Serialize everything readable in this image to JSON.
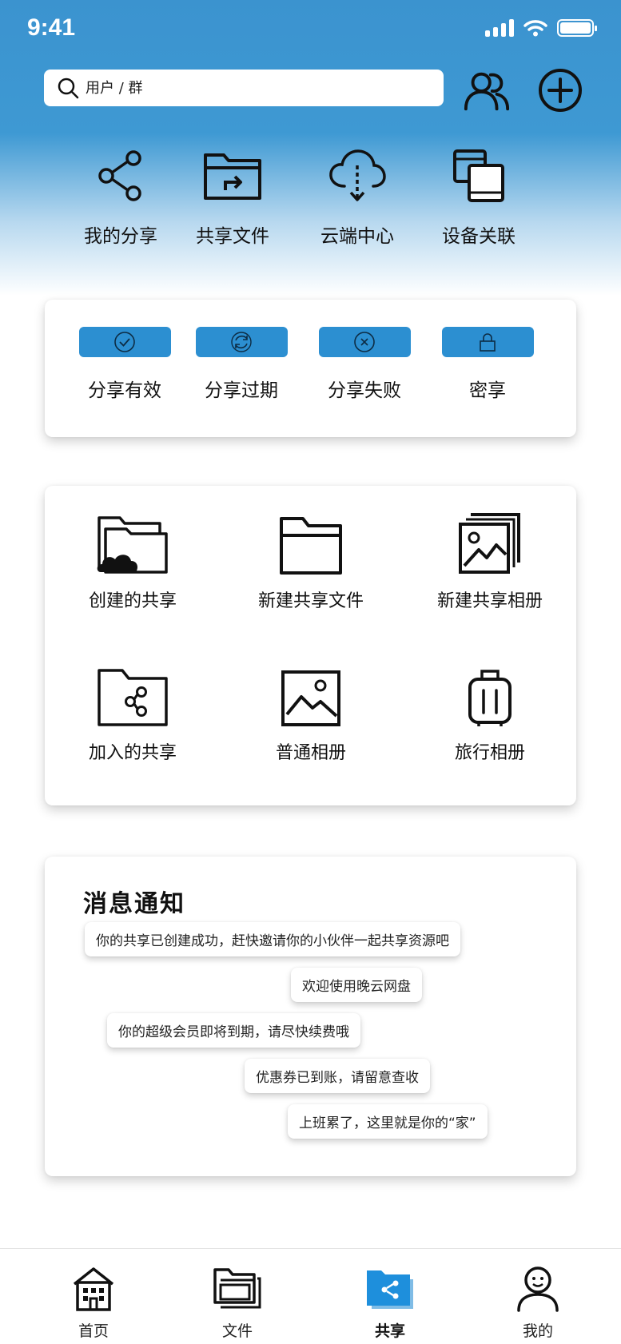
{
  "status_bar": {
    "time": "9:41"
  },
  "search": {
    "placeholder": "用户 / 群"
  },
  "quick_actions": [
    {
      "label": "我的分享",
      "icon": "share-icon"
    },
    {
      "label": "共享文件",
      "icon": "shared-folder-icon"
    },
    {
      "label": "云端中心",
      "icon": "cloud-download-icon"
    },
    {
      "label": "设备关联",
      "icon": "devices-icon"
    }
  ],
  "share_status": [
    {
      "label": "分享有效",
      "icon": "check-circle-icon"
    },
    {
      "label": "分享过期",
      "icon": "refresh-icon"
    },
    {
      "label": "分享失败",
      "icon": "x-circle-icon"
    },
    {
      "label": "密享",
      "icon": "lock-icon"
    }
  ],
  "share_grid": [
    {
      "label": "创建的共享",
      "icon": "cloud-folder-icon"
    },
    {
      "label": "新建共享文件",
      "icon": "folder-icon"
    },
    {
      "label": "新建共享相册",
      "icon": "album-stack-icon"
    },
    {
      "label": "加入的共享",
      "icon": "shared-folder-icon"
    },
    {
      "label": "普通相册",
      "icon": "image-icon"
    },
    {
      "label": "旅行相册",
      "icon": "suitcase-icon"
    }
  ],
  "messages": {
    "title": "消息通知",
    "items": [
      "你的共享已创建成功，赶快邀请你的小伙伴一起共享资源吧",
      "欢迎使用晚云网盘",
      "你的超级会员即将到期，请尽快续费哦",
      "优惠券已到账，请留意查收",
      "上班累了，这里就是你的“家”"
    ]
  },
  "tabs": [
    {
      "label": "首页",
      "icon": "home-icon"
    },
    {
      "label": "文件",
      "icon": "files-icon"
    },
    {
      "label": "共享",
      "icon": "share-folder-icon",
      "active": true
    },
    {
      "label": "我的",
      "icon": "profile-icon"
    }
  ],
  "colors": {
    "accent": "#2c8fd1",
    "header_top": "#3b93cf"
  }
}
